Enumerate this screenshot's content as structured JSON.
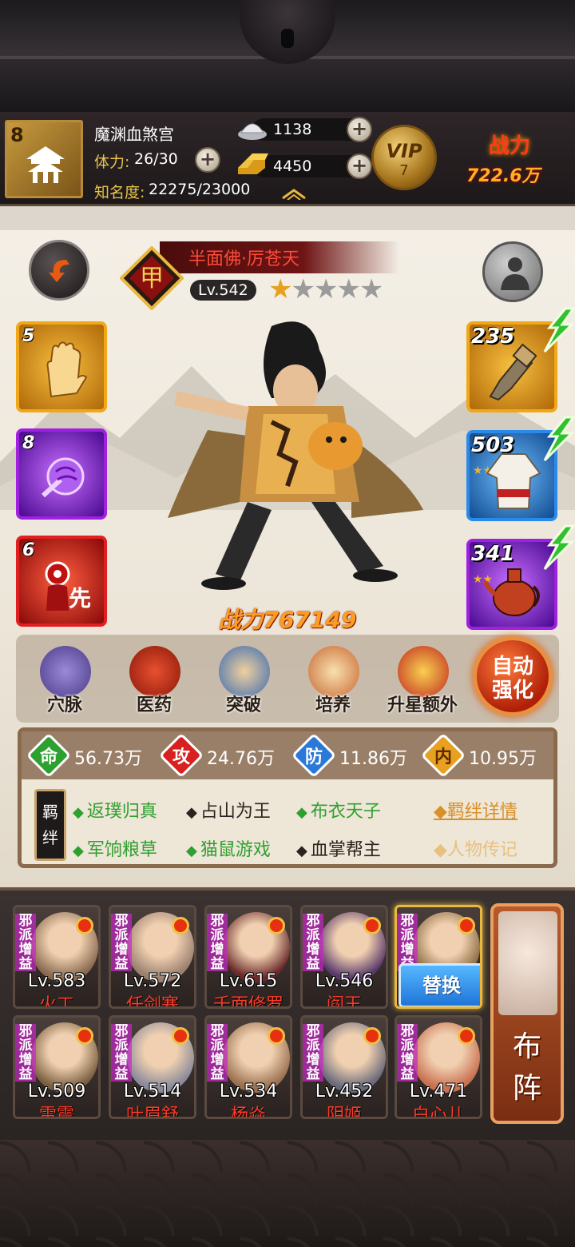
{
  "header": {
    "player_level": "8",
    "player_name": "魔渊血煞宫",
    "stamina_label": "体力:",
    "stamina_value": "26/30",
    "fame_label": "知名度:",
    "fame_value": "22275/23000",
    "silver": "1138",
    "gold": "4450",
    "vip_label": "VIP",
    "vip_level": "7",
    "power_label": "战力",
    "power_value": "722.6万"
  },
  "hero": {
    "name": "半面佛·厉苍天",
    "rank_glyph": "甲",
    "level": "Lv.542",
    "stars_total": 5,
    "stars_filled": 1,
    "power": "战力767149"
  },
  "skills": [
    {
      "count": "5",
      "icon": "palm-icon",
      "color": "#f0a818"
    },
    {
      "count": "8",
      "icon": "fist-icon",
      "color": "#a020e0"
    },
    {
      "count": "6",
      "icon": "first-strike-icon",
      "color": "#e02020",
      "glyph": "先"
    }
  ],
  "equipment": [
    {
      "count": "235",
      "icon": "gauntlet-icon",
      "color": "#f0a818"
    },
    {
      "count": "503",
      "icon": "robe-icon",
      "color": "#2a8ae8"
    },
    {
      "count": "341",
      "icon": "teapot-icon",
      "color": "#a020e0"
    }
  ],
  "functions": [
    {
      "label": "穴脉",
      "icon": "meridian-icon"
    },
    {
      "label": "医药",
      "icon": "medicine-icon"
    },
    {
      "label": "突破",
      "icon": "breakthrough-icon"
    },
    {
      "label": "培养",
      "icon": "cultivate-icon"
    },
    {
      "label": "升星额外",
      "icon": "star-up-icon"
    }
  ],
  "auto_enhance": {
    "line1": "自动",
    "line2": "强化"
  },
  "stats": [
    {
      "glyph": "命",
      "value": "56.73万",
      "color": "#2ea030"
    },
    {
      "glyph": "攻",
      "value": "24.76万",
      "color": "#d82020"
    },
    {
      "glyph": "防",
      "value": "11.86万",
      "color": "#2a78d8"
    },
    {
      "glyph": "内",
      "value": "10.95万",
      "color": "#e8a020"
    }
  ],
  "bond_tag": {
    "line1": "羁",
    "line2": "绊"
  },
  "bonds": [
    {
      "label": "返璞归真",
      "active": true
    },
    {
      "label": "占山为王",
      "active": false
    },
    {
      "label": "布衣天子",
      "active": true
    },
    {
      "label": "军饷粮草",
      "active": true
    },
    {
      "label": "猫鼠游戏",
      "active": true
    },
    {
      "label": "血掌帮主",
      "active": false
    }
  ],
  "links": {
    "bond_detail": "◆羁绊详情",
    "biography": "◆人物传记"
  },
  "roster_tag": "邪派增益",
  "roster": [
    {
      "level": "Lv.583",
      "name": "火工",
      "face": "#8a6a50"
    },
    {
      "level": "Lv.572",
      "name": "任剑寒",
      "face": "#9a8070"
    },
    {
      "level": "Lv.615",
      "name": "千面修罗",
      "face": "#6a2a2a"
    },
    {
      "level": "Lv.546",
      "name": "阎王",
      "face": "#5a3a6a"
    },
    {
      "level": "",
      "name": "",
      "face": "#8a6a40",
      "selected": true
    },
    {
      "level": "Lv.509",
      "name": "雷震",
      "face": "#7a6040"
    },
    {
      "level": "Lv.514",
      "name": "叶眉舒",
      "face": "#8a8a9a"
    },
    {
      "level": "Lv.534",
      "name": "杨焱",
      "face": "#9a7050"
    },
    {
      "level": "Lv.452",
      "name": "阴姬",
      "face": "#6a6a7a"
    },
    {
      "level": "Lv.471",
      "name": "白心儿",
      "face": "#c87050"
    }
  ],
  "swap_label": "替换",
  "formation": {
    "line1": "布",
    "line2": "阵"
  }
}
